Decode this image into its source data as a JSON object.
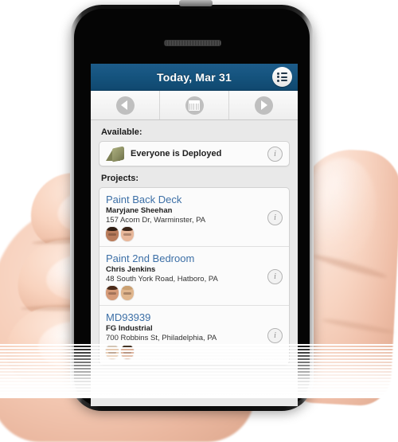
{
  "device": {
    "name": "smartphone",
    "speaker_label": "earpiece-speaker",
    "power_button_label": "power-button"
  },
  "screen": {
    "titlebar": {
      "title": "Today, Mar 31",
      "menu_icon": "list-menu-icon",
      "background_color": "#14527c",
      "text_color": "#ffffff"
    },
    "navbar": {
      "buttons": [
        {
          "name": "previous-day-button",
          "icon": "chevron-left-icon",
          "label": ""
        },
        {
          "name": "calendar-button",
          "icon": "calendar-icon",
          "label": ""
        },
        {
          "name": "next-day-button",
          "icon": "chevron-right-icon",
          "label": ""
        }
      ]
    },
    "available": {
      "heading": "Available:",
      "row": {
        "icon": "tent-icon",
        "text": "Everyone is Deployed",
        "info_icon": "info-icon"
      }
    },
    "projects": {
      "heading": "Projects:",
      "items": [
        {
          "title": "Paint Back Deck",
          "client": "Maryjane Sheehan",
          "address": "157 Acorn Dr, Warminster, PA",
          "info_icon": "info-icon",
          "avatars": [
            "avatar-1",
            "avatar-2"
          ]
        },
        {
          "title": "Paint 2nd Bedroom",
          "client": "Chris Jenkins",
          "address": "48 South York Road, Hatboro, PA",
          "info_icon": "info-icon",
          "avatars": [
            "avatar-3",
            "avatar-4"
          ]
        },
        {
          "title": "MD93939",
          "client": "FG Industrial",
          "address": "700 Robbins St, Philadelphia, PA",
          "info_icon": "info-icon",
          "avatars": [
            "avatar-5",
            "avatar-6"
          ]
        }
      ]
    },
    "colors": {
      "accent_blue": "#14527c",
      "link_blue": "#3c6fa6",
      "page_background": "#e9e9e9",
      "card_background": "#fbfbfb"
    }
  }
}
